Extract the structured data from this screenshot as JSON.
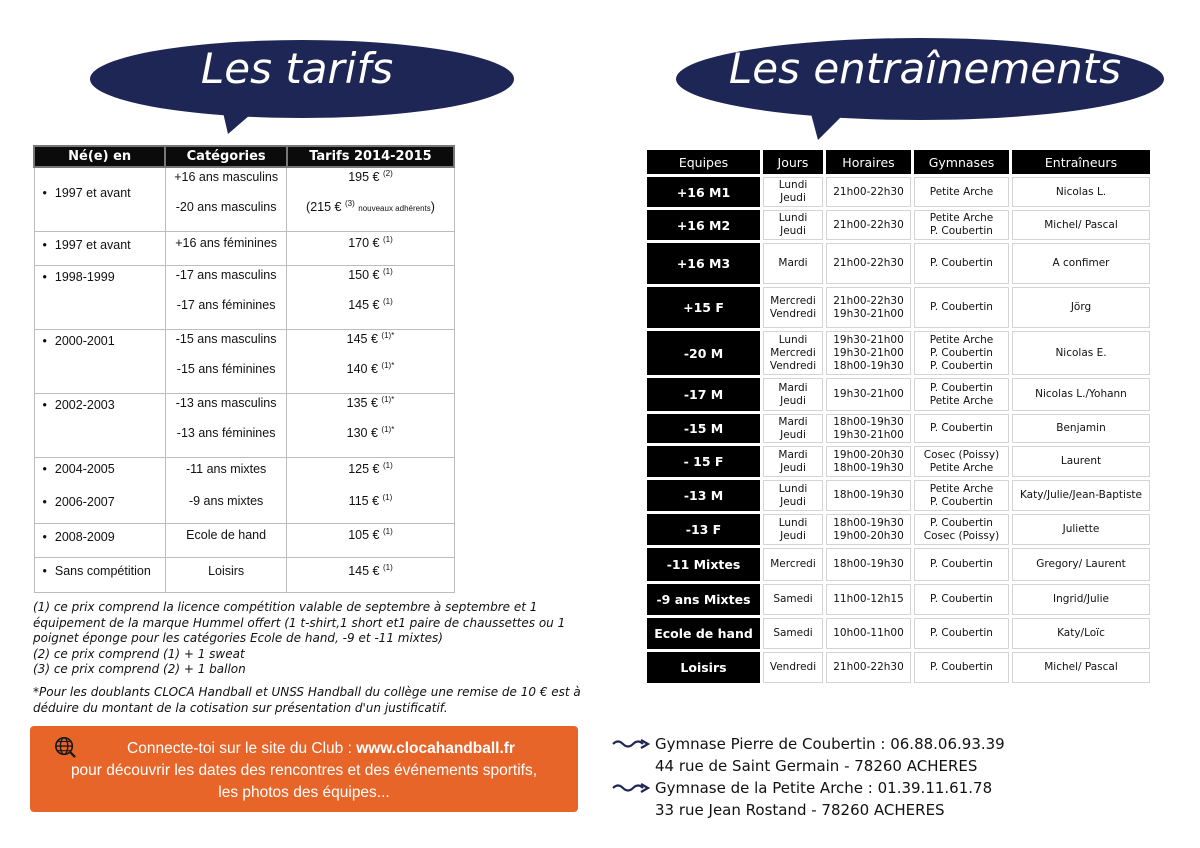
{
  "tarifs": {
    "title": "Les tarifs",
    "headers": [
      "Né(e) en",
      "Catégories",
      "Tarifs 2014-2015"
    ],
    "rows": [
      {
        "year": "1997 et avant",
        "cat1": "+16 ans masculins",
        "price1": "195 €",
        "sup1": "(2)",
        "cat2": "-20 ans masculins",
        "price2": "(215 €",
        "sup2": "(3)",
        "price2_small": "nouveaux adhérents",
        "price2_end": ")"
      },
      {
        "year": "1997 et avant",
        "cat1": "+16 ans féminines",
        "price1": "170 €",
        "sup1": "(1)"
      },
      {
        "year": "1998-1999",
        "cat1": "-17 ans masculins",
        "price1": "150 €",
        "sup1": "(1)",
        "cat2": "-17 ans féminines",
        "price2": "145 €",
        "sup2": "(1)"
      },
      {
        "year": "2000-2001",
        "cat1": "-15 ans masculins",
        "price1": "145 €",
        "sup1": "(1)*",
        "cat2": "-15 ans féminines",
        "price2": "140 €",
        "sup2": "(1)*"
      },
      {
        "year": "2002-2003",
        "cat1": "-13 ans masculins",
        "price1": "135 €",
        "sup1": "(1)*",
        "cat2": "-13 ans féminines",
        "price2": "130 €",
        "sup2": "(1)*"
      },
      {
        "year": "2004-2005",
        "year2": "2006-2007",
        "cat1": "-11 ans mixtes",
        "price1": "125 €",
        "sup1": "(1)",
        "cat2": "-9 ans mixtes",
        "price2": "115 €",
        "sup2": "(1)"
      },
      {
        "year": "2008-2009",
        "cat1": "Ecole de hand",
        "price1": "105 €",
        "sup1": "(1)"
      },
      {
        "year": "Sans compétition",
        "cat1": "Loisirs",
        "price1": "145 €",
        "sup1": "(1)"
      }
    ]
  },
  "notes": {
    "n1": "(1) ce prix comprend la licence compétition valable de septembre à septembre et 1 équipement de la marque Hummel offert (1 t-shirt,1 short et1 paire de chaussettes ou 1 poignet éponge pour les catégories Ecole de hand, -9 et -11 mixtes)",
    "n2": "(2) ce prix comprend (1) + 1 sweat",
    "n3": "(3) ce prix comprend (2) + 1 ballon",
    "remise": "*Pour les doublants CLOCA Handball et UNSS Handball du collège une remise de 10 € est à déduire du montant de la cotisation sur présentation d'un justificatif."
  },
  "banner": {
    "prefix": "Connecte-toi sur le site du Club : ",
    "url": "www.clocahandball.fr",
    "line2": "pour découvrir les dates des rencontres et des événements sportifs,",
    "line3": "les photos des équipes..."
  },
  "trainings": {
    "title": "Les entraînements",
    "headers": [
      "Equipes",
      "Jours",
      "Horaires",
      "Gymnases",
      "Entraîneurs"
    ],
    "rows": [
      {
        "team": "+16 M1",
        "days": [
          "Lundi",
          "Jeudi"
        ],
        "hours": [
          "21h00-22h30"
        ],
        "gyms": [
          "Petite Arche"
        ],
        "coach": "Nicolas L."
      },
      {
        "team": "+16 M2",
        "days": [
          "Lundi",
          "Jeudi"
        ],
        "hours": [
          "21h00-22h30"
        ],
        "gyms": [
          "Petite Arche",
          "P. Coubertin"
        ],
        "coach": "Michel/ Pascal"
      },
      {
        "team": "+16 M3",
        "days": [
          "Mardi"
        ],
        "hours": [
          "21h00-22h30"
        ],
        "gyms": [
          "P. Coubertin"
        ],
        "coach": "A confimer"
      },
      {
        "team": "+15 F",
        "days": [
          "Mercredi",
          "Vendredi"
        ],
        "hours": [
          "21h00-22h30",
          "19h30-21h00"
        ],
        "gyms": [
          "P. Coubertin"
        ],
        "coach": "Jörg"
      },
      {
        "team": "-20 M",
        "days": [
          "Lundi",
          "Mercredi",
          "Vendredi"
        ],
        "hours": [
          "19h30-21h00",
          "19h30-21h00",
          "18h00-19h30"
        ],
        "gyms": [
          "Petite Arche",
          "P. Coubertin",
          "P. Coubertin"
        ],
        "coach": "Nicolas E."
      },
      {
        "team": "-17 M",
        "days": [
          "Mardi",
          "Jeudi"
        ],
        "hours": [
          "19h30-21h00"
        ],
        "gyms": [
          "P. Coubertin",
          "Petite Arche"
        ],
        "coach": "Nicolas L./Yohann"
      },
      {
        "team": "-15 M",
        "days": [
          "Mardi",
          "Jeudi"
        ],
        "hours": [
          "18h00-19h30",
          "19h30-21h00"
        ],
        "gyms": [
          "P. Coubertin"
        ],
        "coach": "Benjamin"
      },
      {
        "team": "- 15 F",
        "days": [
          "Mardi",
          "Jeudi"
        ],
        "hours": [
          "19h00-20h30",
          "18h00-19h30"
        ],
        "gyms": [
          "Cosec (Poissy)",
          "Petite Arche"
        ],
        "coach": "Laurent"
      },
      {
        "team": "-13 M",
        "days": [
          "Lundi",
          "Jeudi"
        ],
        "hours": [
          "18h00-19h30"
        ],
        "gyms": [
          "Petite Arche",
          "P. Coubertin"
        ],
        "coach": "Katy/Julie/Jean-Baptiste"
      },
      {
        "team": "-13 F",
        "days": [
          "Lundi",
          "Jeudi"
        ],
        "hours": [
          "18h00-19h30",
          "19h00-20h30"
        ],
        "gyms": [
          "P. Coubertin",
          "Cosec (Poissy)"
        ],
        "coach": "Juliette"
      },
      {
        "team": "-11 Mixtes",
        "days": [
          "Mercredi"
        ],
        "hours": [
          "18h00-19h30"
        ],
        "gyms": [
          "P. Coubertin"
        ],
        "coach": "Gregory/ Laurent"
      },
      {
        "team": "-9 ans Mixtes",
        "days": [
          "Samedi"
        ],
        "hours": [
          "11h00-12h15"
        ],
        "gyms": [
          "P. Coubertin"
        ],
        "coach": "Ingrid/Julie"
      },
      {
        "team": "Ecole de hand",
        "days": [
          "Samedi"
        ],
        "hours": [
          "10h00-11h00"
        ],
        "gyms": [
          "P. Coubertin"
        ],
        "coach": "Katy/Loïc"
      },
      {
        "team": "Loisirs",
        "days": [
          "Vendredi"
        ],
        "hours": [
          "21h00-22h30"
        ],
        "gyms": [
          "P. Coubertin"
        ],
        "coach": "Michel/ Pascal"
      }
    ]
  },
  "gyms": [
    {
      "name": "Gymnase Pierre de Coubertin : 06.88.06.93.39",
      "address": "44 rue de Saint Germain - 78260 ACHERES"
    },
    {
      "name": "Gymnase de la Petite Arche : 01.39.11.61.78",
      "address": "33 rue Jean Rostand - 78260 ACHERES"
    }
  ],
  "colors": {
    "bubble": "#1d2654",
    "banner": "#e8652a",
    "header": "#000000"
  },
  "icons": {
    "banner": "globe-icon",
    "gyms": "double-arrow-icon"
  }
}
